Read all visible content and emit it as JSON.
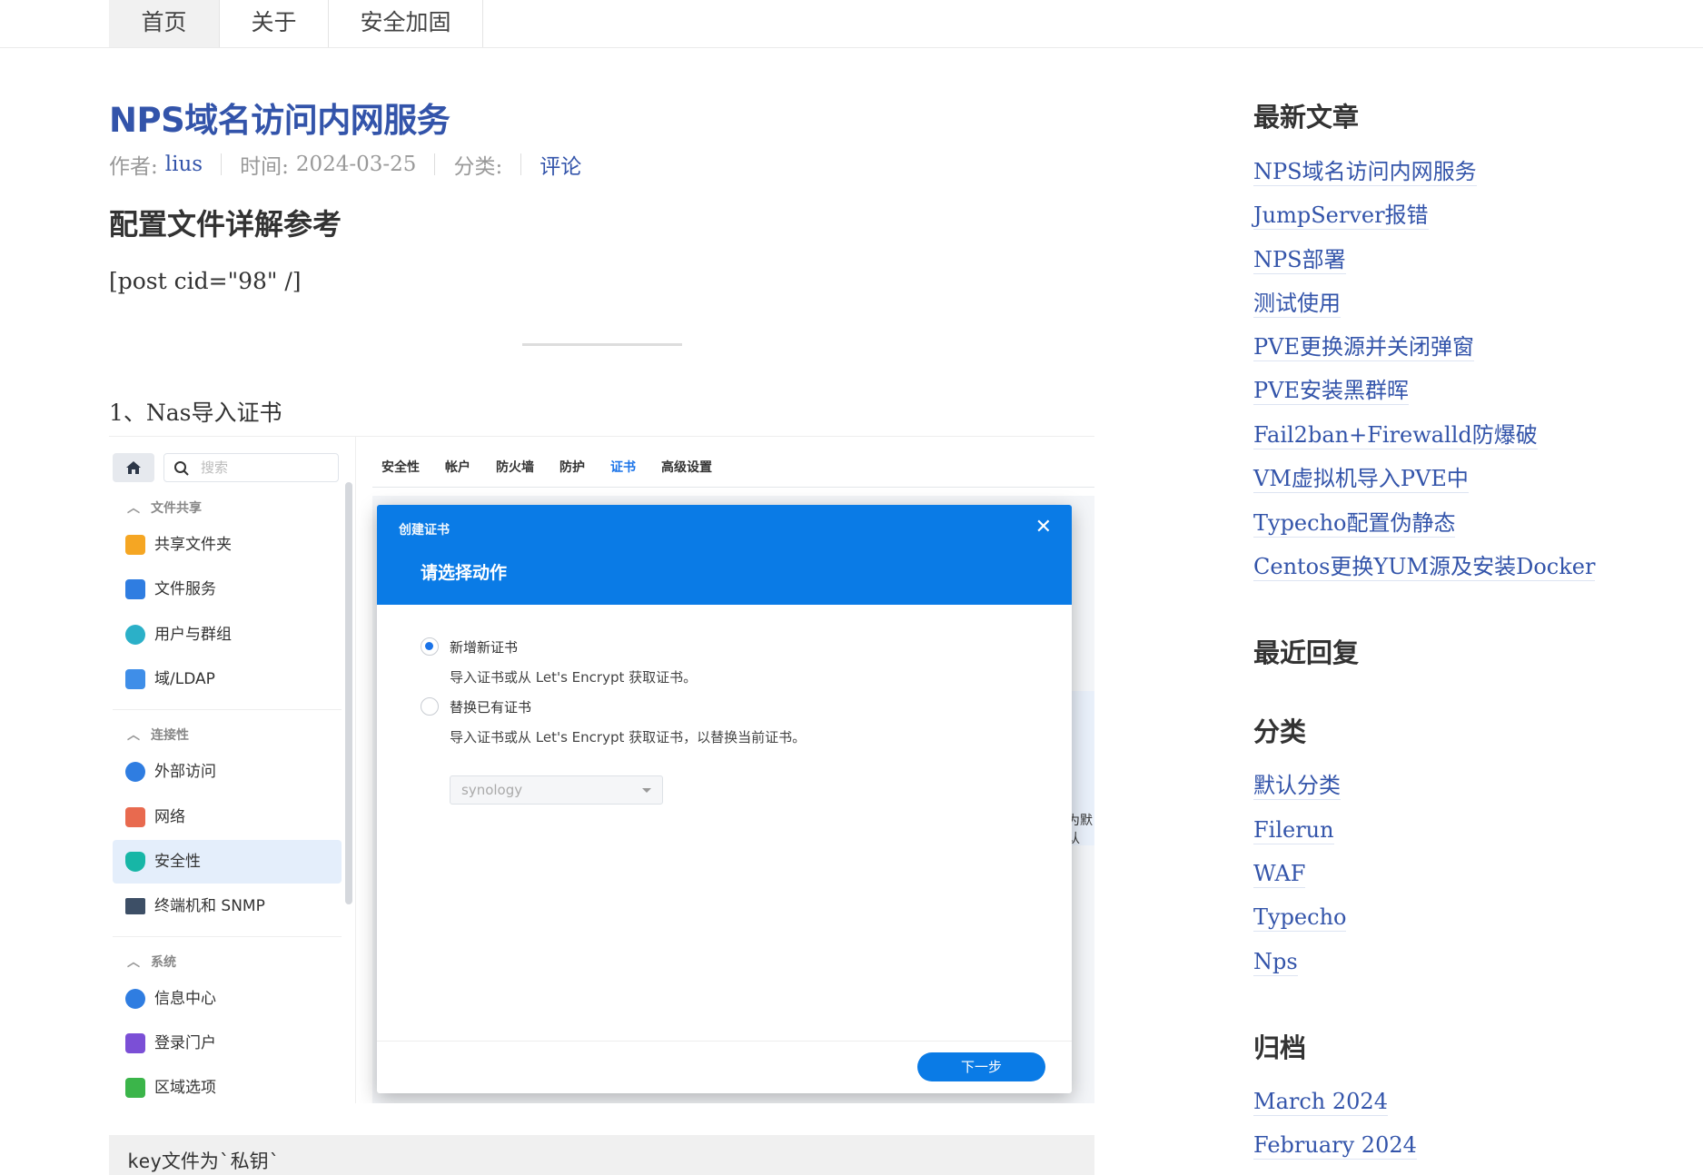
{
  "nav": {
    "items": [
      "首页",
      "关于",
      "安全加固"
    ]
  },
  "post": {
    "title": "NPS域名访问内网服务",
    "author_label": "作者:",
    "author": "lius",
    "time_label": "时间:",
    "time": "2024-03-25",
    "category_label": "分类:",
    "category": "评论",
    "heading": "配置文件详解参考",
    "shortcode": "[post cid=\"98\" /]",
    "step1": "1、Nas导入证书",
    "code_text": "key文件为`私钥`"
  },
  "dsm": {
    "search_placeholder": "搜索",
    "sections": [
      "文件共享",
      "连接性",
      "系统"
    ],
    "items": [
      "共享文件夹",
      "文件服务",
      "用户与群组",
      "域/LDAP",
      "外部访问",
      "网络",
      "安全性",
      "终端机和 SNMP",
      "信息中心",
      "登录门户",
      "区域选项"
    ],
    "tabs": [
      "安全性",
      "帐户",
      "防火墙",
      "防护",
      "证书",
      "高级设置"
    ],
    "bg_text": "为默认",
    "modal": {
      "subtitle": "创建证书",
      "title": "请选择动作",
      "close": "✕",
      "option1": "新增新证书",
      "option1_desc": "导入证书或从 Let's Encrypt 获取证书。",
      "option2": "替换已有证书",
      "option2_desc": "导入证书或从 Let's Encrypt 获取证书，以替换当前证书。",
      "select_value": "synology",
      "next": "下一步"
    }
  },
  "sidebar": {
    "recent_title": "最新文章",
    "recent": [
      "NPS域名访问内网服务",
      "JumpServer报错",
      "NPS部署",
      "测试使用",
      "PVE更换源并关闭弹窗",
      "PVE安装黑群晖",
      "Fail2ban+Firewalld防爆破",
      "VM虚拟机导入PVE中",
      "Typecho配置伪静态",
      "Centos更换YUM源及安装Docker"
    ],
    "replies_title": "最近回复",
    "categories_title": "分类",
    "categories": [
      "默认分类",
      "Filerun",
      "WAF",
      "Typecho",
      "Nps"
    ],
    "archive_title": "归档",
    "archives": [
      "March 2024",
      "February 2024"
    ]
  },
  "colors": {
    "link": "#3354aa",
    "dsm_blue": "#0a7be6",
    "tab_active": "#1a73e8"
  }
}
